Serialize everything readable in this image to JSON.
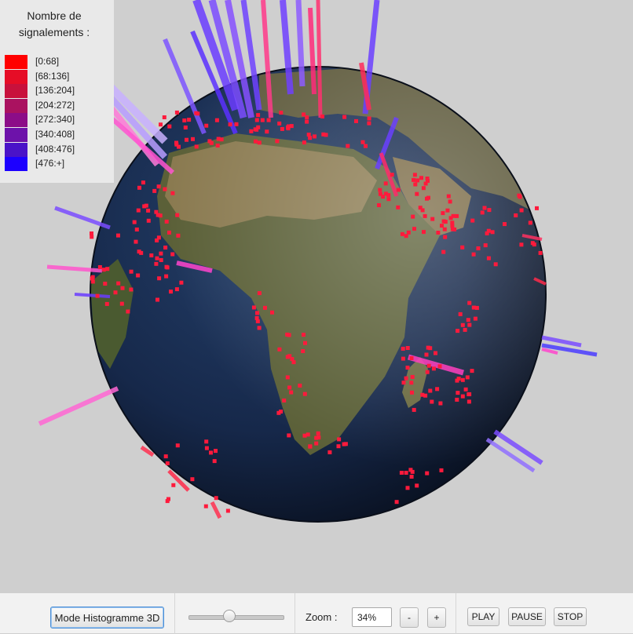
{
  "legend": {
    "title_line1": "Nombre de",
    "title_line2": "signalements :",
    "items": [
      {
        "label": "[0:68]",
        "color": "#ff0000"
      },
      {
        "label": "[68:136]",
        "color": "#e60d26"
      },
      {
        "label": "[136:204]",
        "color": "#c8113c"
      },
      {
        "label": "[204:272]",
        "color": "#aa1260"
      },
      {
        "label": "[272:340]",
        "color": "#8c0d88"
      },
      {
        "label": "[340:408]",
        "color": "#6d12aa"
      },
      {
        "label": "[408:476]",
        "color": "#4a13c8"
      },
      {
        "label": "[476:+]",
        "color": "#1c00ff"
      }
    ]
  },
  "toolbar": {
    "mode_button": "Mode Histogramme 3D",
    "zoom_label": "Zoom :",
    "zoom_value": "34%",
    "zoom_minus": "-",
    "zoom_plus": "+",
    "play": "PLAY",
    "pause": "PAUSE",
    "stop": "STOP"
  },
  "colors": {
    "bar_low": "#ff1a3c",
    "bar_mid": "#ff44d0",
    "bar_high": "#6a3cff",
    "ocean": "#14243f",
    "land": "#5b5a3c"
  },
  "icons": {
    "globe": "earth-globe-icon"
  }
}
